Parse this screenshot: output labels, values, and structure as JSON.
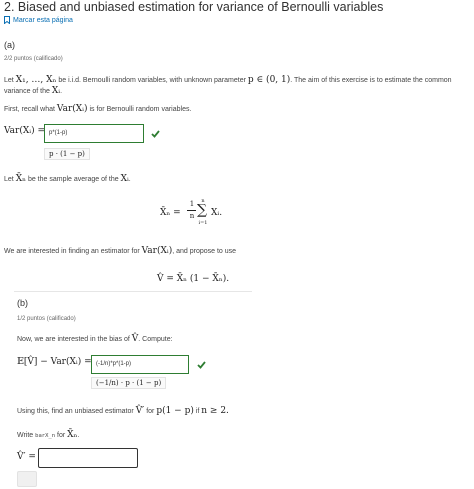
{
  "header": {
    "title": "2. Biased and unbiased estimation for variance of Bernoulli variables",
    "bookmark_label": "Marcar esta página"
  },
  "part_a": {
    "label": "(a)",
    "score": "2/2 puntos (calificado)",
    "intro_prefix": "Let",
    "intro_vars": "X₁, …, Xₙ",
    "intro_mid": "be i.i.d. Bernoulli random variables, with unknown parameter",
    "intro_param": "p ∈ (0, 1)",
    "intro_suffix": ". The aim of this exercise is to estimate the common",
    "intro_line2_prefix": "variance of the",
    "intro_line2_var": "Xᵢ",
    "intro_line2_suffix": ".",
    "recall_prefix": "First, recall what",
    "recall_math": "Var(Xᵢ)",
    "recall_suffix": "is for Bernoulli random variables.",
    "q1_lhs": "Var(Xᵢ) =",
    "q1_value": "p*(1-p)",
    "q1_preview": "p · (1 − p)",
    "let_prefix": "Let",
    "let_math": "X̄ₙ",
    "let_mid": "be the sample average of the",
    "let_var": "Xᵢ",
    "let_suffix": ".",
    "formula_lhs": "X̄ₙ =",
    "formula_frac_num": "1",
    "formula_frac_den": "n",
    "formula_sum": "∑",
    "formula_sum_top": "n",
    "formula_sum_bottom": "i=1",
    "formula_term": "Xᵢ.",
    "interest_prefix": "We are interested in finding an estimator for",
    "interest_math": "Var(Xᵢ)",
    "interest_suffix": ", and propose to use",
    "vhat_formula": "V̂ = X̄ₙ (1 − X̄ₙ)."
  },
  "part_b": {
    "label": "(b)",
    "score": "1/2 puntos (calificado)",
    "bias_prefix": "Now, we are interested in the bias of",
    "bias_math": "V̂",
    "bias_suffix": ". Compute:",
    "q2_lhs": "𝔼[V̂] − Var(Xᵢ) =",
    "q2_value": "(-1/n)*p*(1-p)",
    "q2_preview": "(−1/n) · p · (1 − p)",
    "using_prefix": "Using this, find an unbiased estimator",
    "using_math": "V̂′",
    "using_mid": "for",
    "using_param": "p(1 − p)",
    "using_mid2": "if",
    "using_cond": "n ≥ 2.",
    "write_prefix": "Write",
    "write_code": "barX_n",
    "write_mid": "for",
    "write_math": "X̄ₙ",
    "write_suffix": ".",
    "q3_lhs": "V̂′ =",
    "q3_value": ""
  },
  "colors": {
    "correct_border": "#2e7d32",
    "check": "#2e7d32",
    "link": "#0a6fb3"
  }
}
